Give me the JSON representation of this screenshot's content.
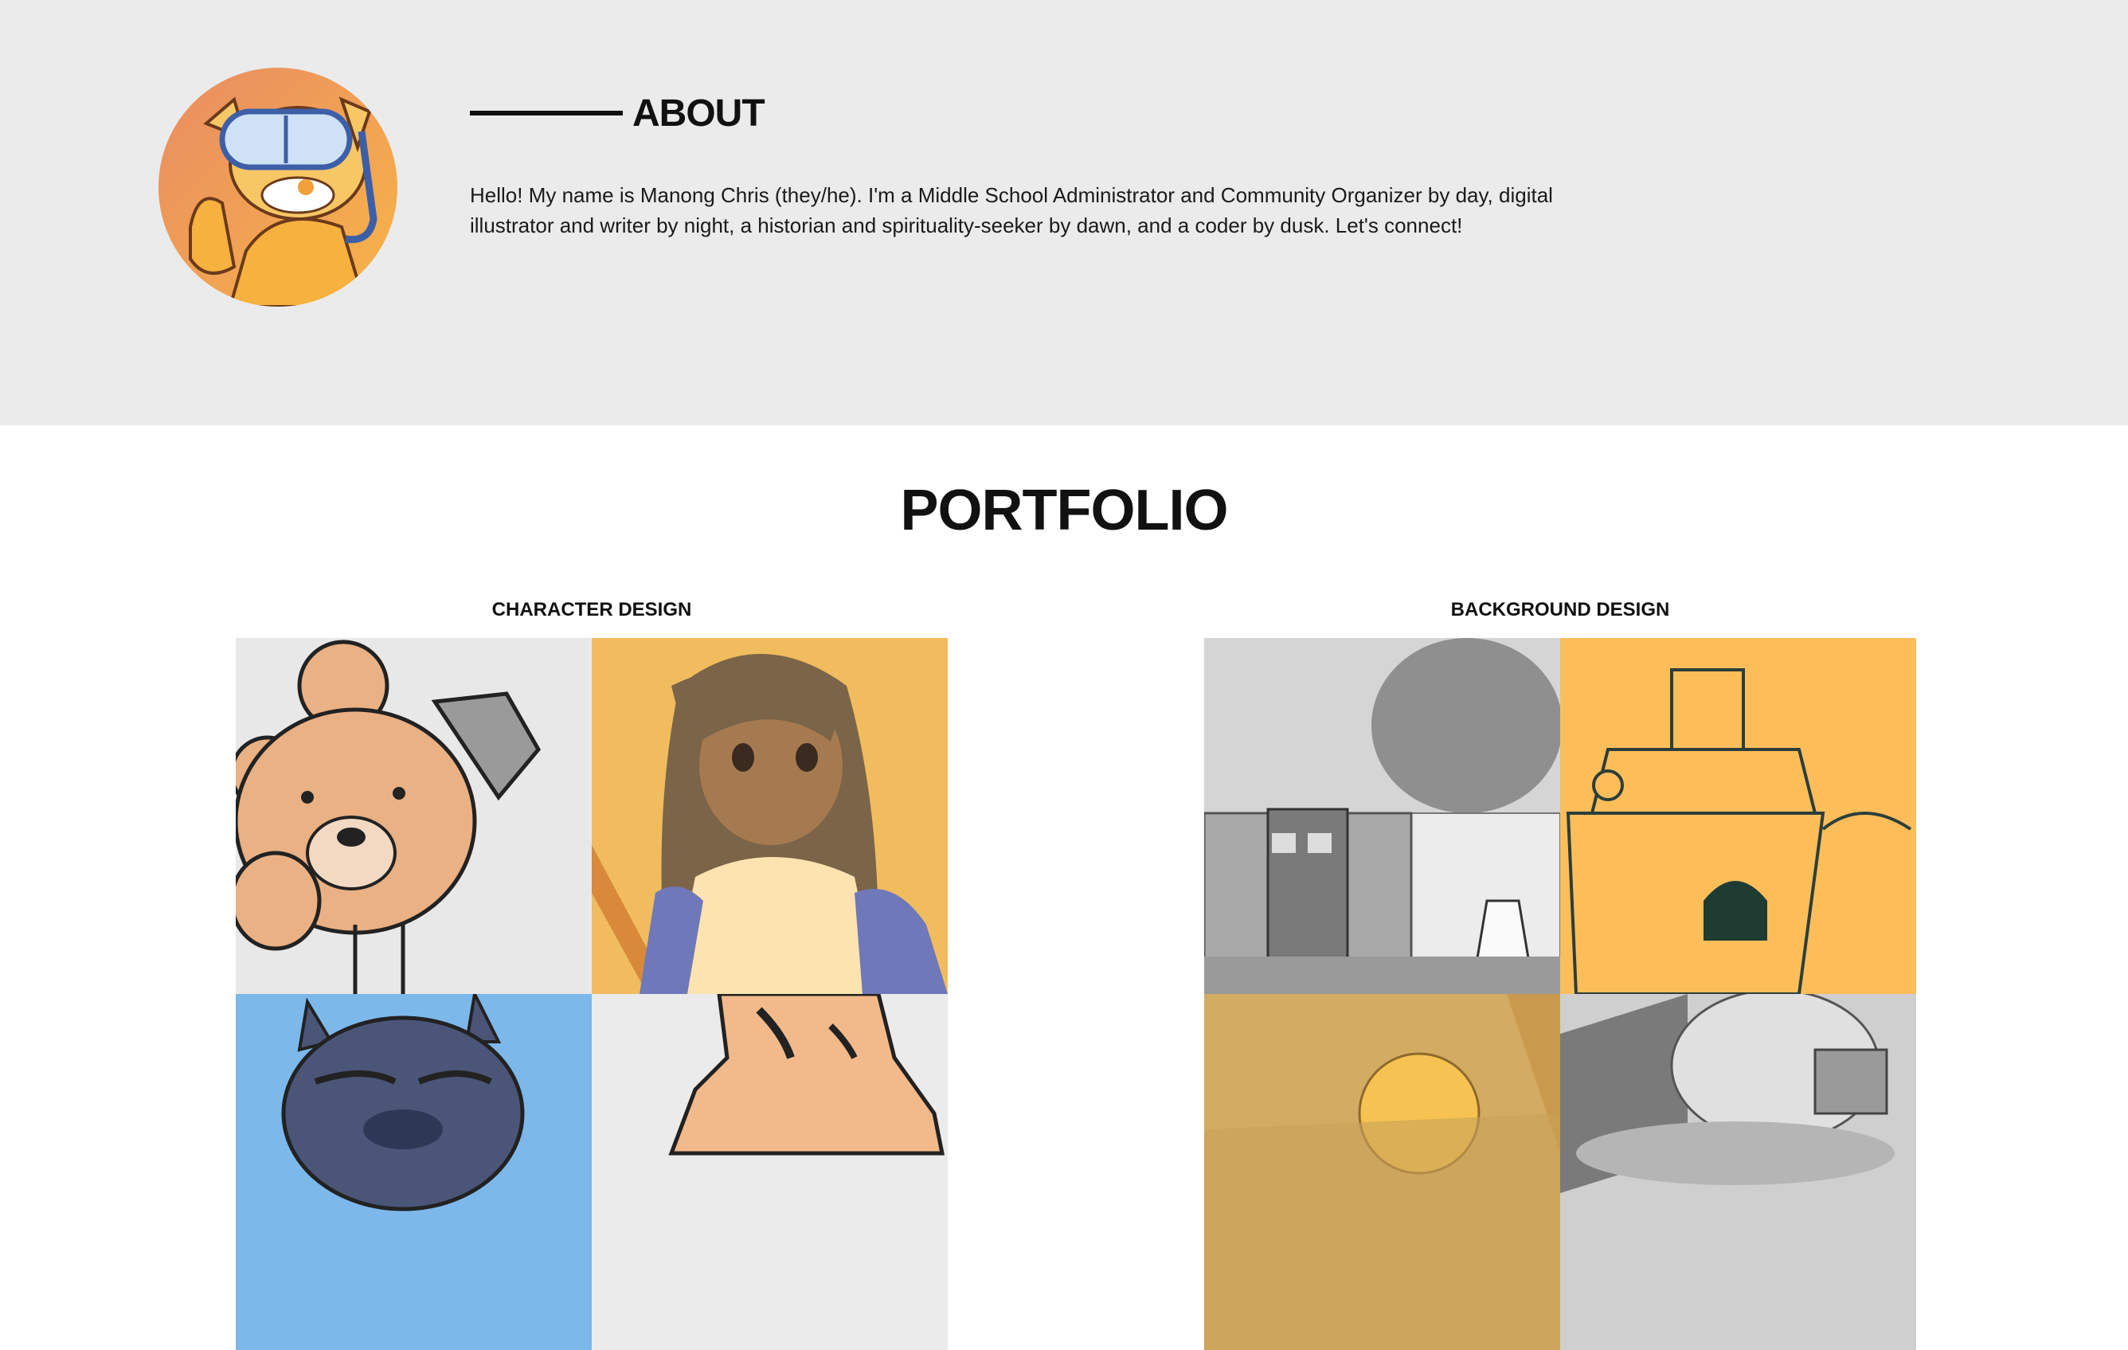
{
  "about": {
    "title": "ABOUT",
    "text": "Hello! My name is Manong Chris (they/he). I'm a Middle School Administrator and Community Organizer by day, digital illustrator and writer by night, a historian and spirituality-seeker by dawn, and a coder by dusk. Let's connect!",
    "avatar_icon": "cartoon-cat-snorkel-avatar"
  },
  "portfolio": {
    "title": "PORTFOLIO",
    "categories": [
      {
        "label": "CHARACTER DESIGN"
      },
      {
        "label": "BACKGROUND DESIGN"
      }
    ]
  },
  "colors": {
    "about_bg": "#ebebeb",
    "page_bg": "#ffffff",
    "accent_yellow": "#fdbe5a",
    "accent_blue": "#7db8ea"
  }
}
